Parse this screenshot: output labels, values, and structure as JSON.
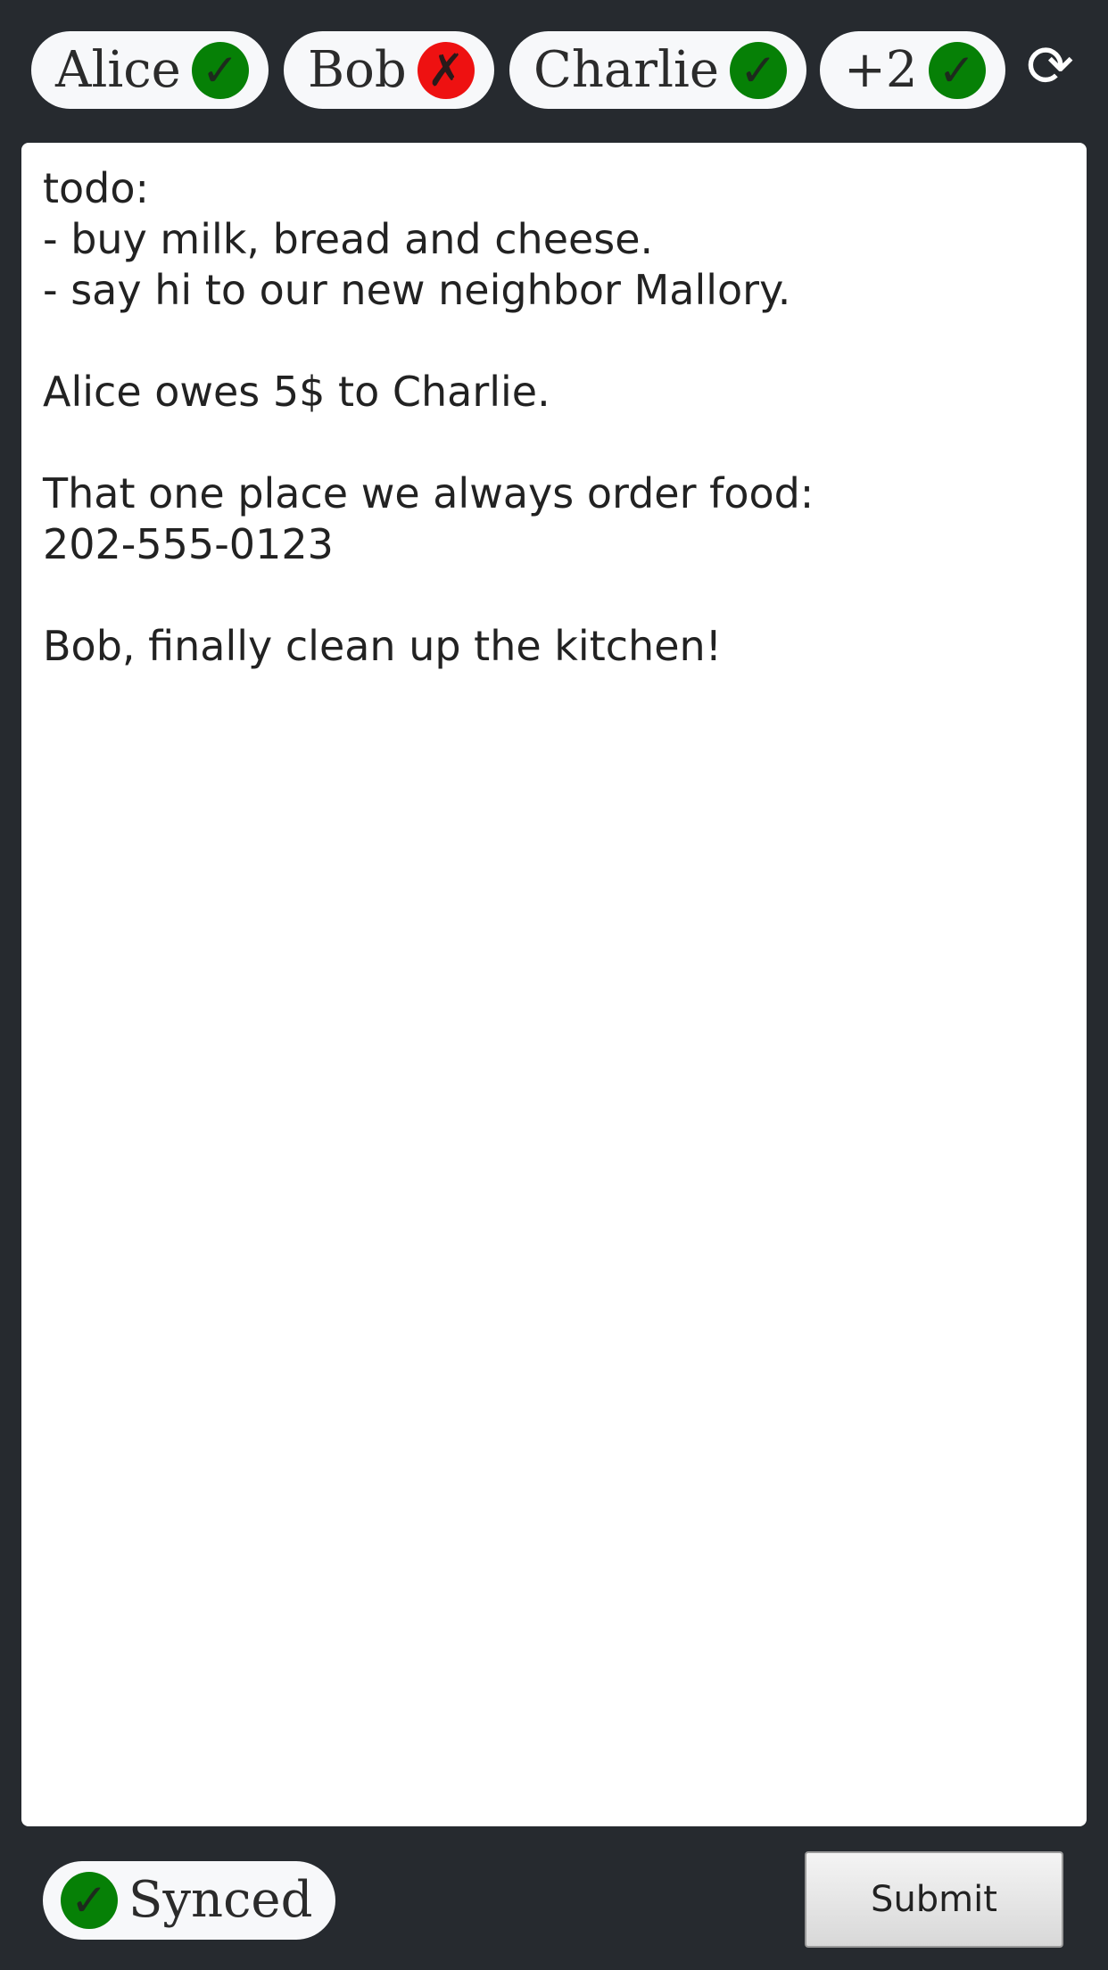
{
  "collaborators": [
    {
      "name": "Alice",
      "status": "ok",
      "status_icon": "✓"
    },
    {
      "name": "Bob",
      "status": "error",
      "status_icon": "✗"
    },
    {
      "name": "Charlie",
      "status": "ok",
      "status_icon": "✓"
    },
    {
      "name": "+2",
      "status": "ok",
      "status_icon": "✓"
    }
  ],
  "toolbar": {
    "refresh_icon": "⟳"
  },
  "editor": {
    "content": "todo:\n- buy milk, bread and cheese.\n- say hi to our new neighbor Mallory.\n\nAlice owes 5$ to Charlie.\n\nThat one place we always order food:\n202-555-0123\n\nBob, finally clean up the kitchen!"
  },
  "footer": {
    "sync_label": "Synced",
    "sync_icon": "✓",
    "submit_label": "Submit"
  },
  "colors": {
    "background": "#262a2f",
    "ok": "#068006",
    "error": "#ee1111",
    "pill": "#f7f8fa"
  }
}
